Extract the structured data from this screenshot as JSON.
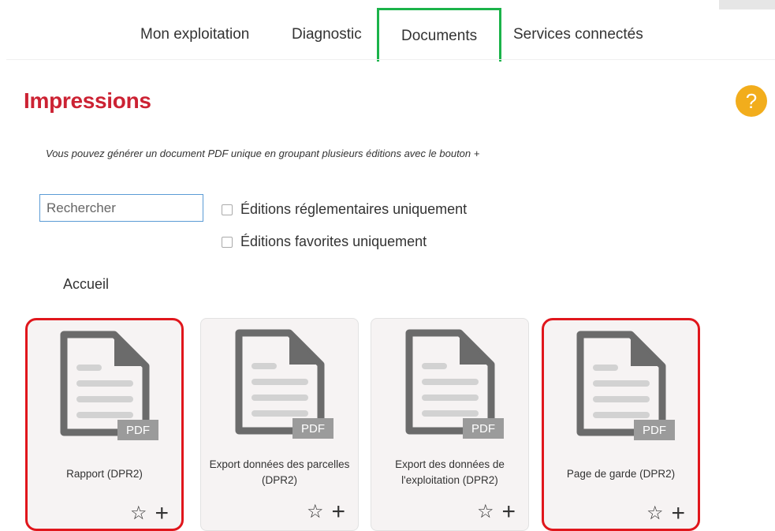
{
  "nav": {
    "tabs": [
      {
        "label": "Mon exploitation"
      },
      {
        "label": "Diagnostic"
      },
      {
        "label": "Documents",
        "active": true
      },
      {
        "label": "Services connectés"
      }
    ]
  },
  "page": {
    "title": "Impressions",
    "help_symbol": "?",
    "hint": "Vous pouvez générer un document PDF unique en groupant plusieurs éditions avec le bouton +"
  },
  "filters": {
    "search_placeholder": "Rechercher",
    "checkbox_regulatory": "Éditions réglementaires uniquement",
    "checkbox_favorites": "Éditions favorites uniquement"
  },
  "section": {
    "label": "Accueil"
  },
  "cards": [
    {
      "title": "Rapport (DPR2)",
      "badge": "PDF",
      "highlighted": true
    },
    {
      "title": "Export données des parcelles (DPR2)",
      "badge": "PDF",
      "highlighted": false
    },
    {
      "title": "Export des données de l'exploitation (DPR2)",
      "badge": "PDF",
      "highlighted": false
    },
    {
      "title": "Page de garde (DPR2)",
      "badge": "PDF",
      "highlighted": true
    }
  ],
  "icons": {
    "star": "star-outline-icon",
    "plus": "plus-icon",
    "document": "pdf-document-icon"
  },
  "colors": {
    "title_red": "#cc2233",
    "highlight_red": "#e0161c",
    "active_tab_green": "#1bb34a",
    "help_yellow": "#f2ad1c"
  }
}
